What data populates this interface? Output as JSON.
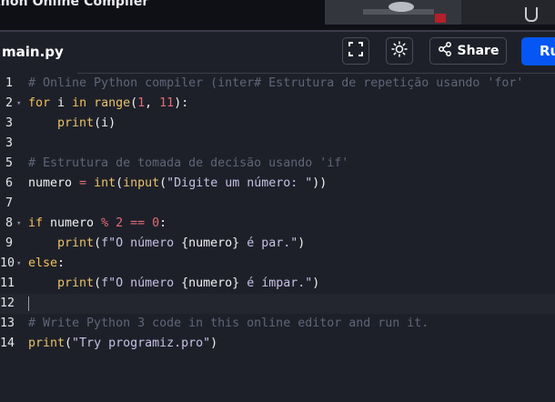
{
  "page": {
    "title": "thon Online Compiler"
  },
  "editor": {
    "file_tab": "main.py",
    "share_label": "Share",
    "run_label": "Run"
  },
  "code_lines": [
    {
      "n": "1",
      "fold": false,
      "tokens": [
        {
          "c": "cm",
          "t": "# Online Python compiler (inter# Estrutura de repetição usando 'for'"
        }
      ]
    },
    {
      "n": "2",
      "fold": true,
      "tokens": [
        {
          "c": "kw",
          "t": "for"
        },
        {
          "c": "",
          "t": " i "
        },
        {
          "c": "kw",
          "t": "in"
        },
        {
          "c": "",
          "t": " "
        },
        {
          "c": "fn",
          "t": "range"
        },
        {
          "c": "",
          "t": "("
        },
        {
          "c": "num",
          "t": "1"
        },
        {
          "c": "",
          "t": ", "
        },
        {
          "c": "num",
          "t": "11"
        },
        {
          "c": "",
          "t": "):"
        }
      ]
    },
    {
      "n": "3",
      "fold": false,
      "tokens": [
        {
          "c": "",
          "t": "    "
        },
        {
          "c": "fn",
          "t": "print"
        },
        {
          "c": "",
          "t": "(i)"
        }
      ]
    },
    {
      "n": "3",
      "fold": false,
      "tokens": []
    },
    {
      "n": "5",
      "fold": false,
      "tokens": [
        {
          "c": "cm",
          "t": "# Estrutura de tomada de decisão usando 'if'"
        }
      ]
    },
    {
      "n": "6",
      "fold": false,
      "tokens": [
        {
          "c": "",
          "t": "numero "
        },
        {
          "c": "op",
          "t": "="
        },
        {
          "c": "",
          "t": " "
        },
        {
          "c": "fn",
          "t": "int"
        },
        {
          "c": "",
          "t": "("
        },
        {
          "c": "fn",
          "t": "input"
        },
        {
          "c": "",
          "t": "("
        },
        {
          "c": "str",
          "t": "\"Digite um número: \""
        },
        {
          "c": "",
          "t": "))"
        }
      ]
    },
    {
      "n": "7",
      "fold": false,
      "tokens": []
    },
    {
      "n": "8",
      "fold": true,
      "tokens": [
        {
          "c": "kw",
          "t": "if"
        },
        {
          "c": "",
          "t": " numero "
        },
        {
          "c": "op",
          "t": "%"
        },
        {
          "c": "",
          "t": " "
        },
        {
          "c": "num",
          "t": "2"
        },
        {
          "c": "",
          "t": " "
        },
        {
          "c": "op",
          "t": "=="
        },
        {
          "c": "",
          "t": " "
        },
        {
          "c": "num",
          "t": "0"
        },
        {
          "c": "",
          "t": ":"
        }
      ]
    },
    {
      "n": "9",
      "fold": false,
      "tokens": [
        {
          "c": "",
          "t": "    "
        },
        {
          "c": "fn",
          "t": "print"
        },
        {
          "c": "",
          "t": "("
        },
        {
          "c": "str",
          "t": "f\"O número "
        },
        {
          "c": "",
          "t": "{numero}"
        },
        {
          "c": "str",
          "t": " é par.\""
        },
        {
          "c": "",
          "t": ")"
        }
      ]
    },
    {
      "n": "10",
      "fold": true,
      "tokens": [
        {
          "c": "kw",
          "t": "else"
        },
        {
          "c": "",
          "t": ":"
        }
      ]
    },
    {
      "n": "11",
      "fold": false,
      "tokens": [
        {
          "c": "",
          "t": "    "
        },
        {
          "c": "fn",
          "t": "print"
        },
        {
          "c": "",
          "t": "("
        },
        {
          "c": "str",
          "t": "f\"O número "
        },
        {
          "c": "",
          "t": "{numero}"
        },
        {
          "c": "str",
          "t": " é ímpar.\""
        },
        {
          "c": "",
          "t": ")"
        }
      ]
    },
    {
      "n": "12",
      "fold": false,
      "active": true,
      "tokens": []
    },
    {
      "n": "13",
      "fold": false,
      "tokens": [
        {
          "c": "cm",
          "t": "# Write Python 3 code in this online editor and run it."
        }
      ]
    },
    {
      "n": "14",
      "fold": false,
      "tokens": [
        {
          "c": "fn",
          "t": "print"
        },
        {
          "c": "",
          "t": "("
        },
        {
          "c": "str",
          "t": "\"Try programiz.pro\""
        },
        {
          "c": "",
          "t": ")"
        }
      ]
    }
  ],
  "icons": {
    "fullscreen": "fullscreen-icon",
    "theme": "sun-icon",
    "share": "share-icon"
  },
  "colors": {
    "background": "#1e2029",
    "run_button": "#0556f3",
    "keyword": "#f0c05c",
    "number": "#e06c75",
    "string": "#c7c0e6",
    "comment": "#5f6477"
  }
}
